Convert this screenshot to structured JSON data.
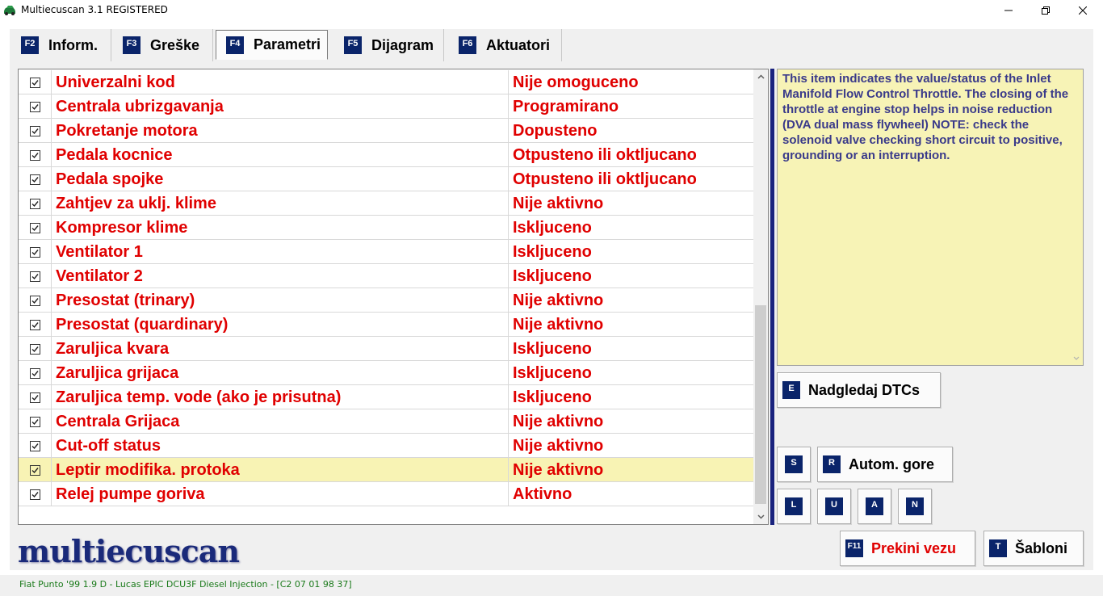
{
  "window": {
    "title": "Multiecuscan 3.1 REGISTERED",
    "icon": "car-app-icon"
  },
  "tabs": [
    {
      "key": "F2",
      "label": "Inform."
    },
    {
      "key": "F3",
      "label": "Greške"
    },
    {
      "key": "F4",
      "label": "Parametri",
      "active": true
    },
    {
      "key": "F5",
      "label": "Dijagram"
    },
    {
      "key": "F6",
      "label": "Aktuatori"
    }
  ],
  "parameters": [
    {
      "name": "Univerzalni kod",
      "value": "Nije omoguceno",
      "checked": true
    },
    {
      "name": "Centrala ubrizgavanja",
      "value": "Programirano",
      "checked": true
    },
    {
      "name": "Pokretanje motora",
      "value": "Dopusteno",
      "checked": true
    },
    {
      "name": "Pedala kocnice",
      "value": "Otpusteno ili oktljucano",
      "checked": true
    },
    {
      "name": "Pedala spojke",
      "value": "Otpusteno ili oktljucano",
      "checked": true
    },
    {
      "name": "Zahtjev za uklj. klime",
      "value": "Nije aktivno",
      "checked": true
    },
    {
      "name": "Kompresor klime",
      "value": "Iskljuceno",
      "checked": true
    },
    {
      "name": "Ventilator 1",
      "value": "Iskljuceno",
      "checked": true
    },
    {
      "name": "Ventilator 2",
      "value": "Iskljuceno",
      "checked": true
    },
    {
      "name": "Presostat (trinary)",
      "value": "Nije aktivno",
      "checked": true
    },
    {
      "name": "Presostat (quardinary)",
      "value": "Nije aktivno",
      "checked": true
    },
    {
      "name": "Zaruljica kvara",
      "value": "Iskljuceno",
      "checked": true
    },
    {
      "name": "Zaruljica grijaca",
      "value": "Iskljuceno",
      "checked": true
    },
    {
      "name": "Zaruljica temp. vode (ako je prisutna)",
      "value": "Iskljuceno",
      "checked": true
    },
    {
      "name": "Centrala Grijaca",
      "value": "Nije aktivno",
      "checked": true
    },
    {
      "name": "Cut-off status",
      "value": "Nije aktivno",
      "checked": true
    },
    {
      "name": "Leptir modifika. protoka",
      "value": "Nije aktivno",
      "checked": true,
      "selected": true
    },
    {
      "name": "Relej pumpe goriva",
      "value": "Aktivno",
      "checked": true
    }
  ],
  "info": {
    "text": "This item indicates the value/status of the Inlet Manifold Flow Control Throttle. The closing of the throttle at engine stop helps in noise reduction (DVA dual mass flywheel) NOTE: check the solenoid valve checking short circuit to positive, grounding or an interruption."
  },
  "buttons": {
    "monitor_dtcs": {
      "key": "E",
      "label": "Nadgledaj DTCs"
    },
    "s": {
      "key": "S"
    },
    "auto_up": {
      "key": "R",
      "label": "Autom. gore"
    },
    "l": {
      "key": "L"
    },
    "u": {
      "key": "U"
    },
    "a": {
      "key": "A"
    },
    "n": {
      "key": "N"
    },
    "disconnect": {
      "key": "F11",
      "label": "Prekini vezu"
    },
    "templates": {
      "key": "T",
      "label": "Šabloni"
    }
  },
  "logo": "multiecuscan",
  "status": "Fiat Punto '99 1.9 D - Lucas EPIC DCU3F Diesel Injection - [C2 07 01 98 37]",
  "colors": {
    "accent_navy": "#0a246a",
    "value_red": "#e00000",
    "info_bg": "#f7f3b6",
    "info_text": "#3a3a8a",
    "selected_row": "#f8f3b4",
    "status_green": "#1a7a1a"
  }
}
